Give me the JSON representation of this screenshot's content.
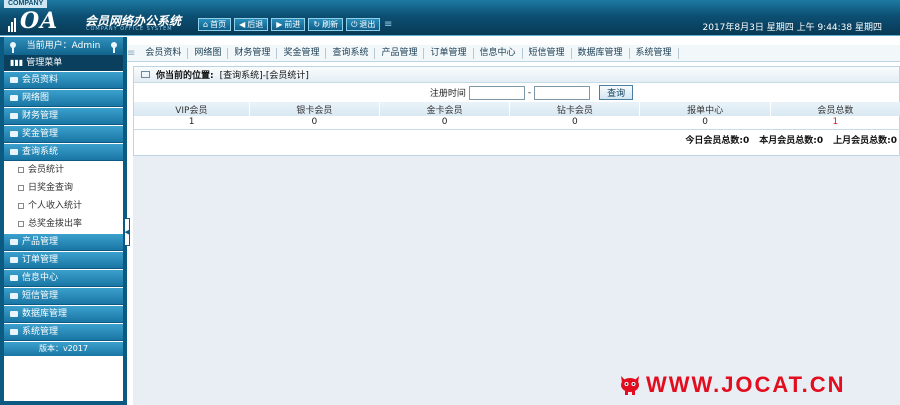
{
  "header": {
    "company_tag": "COMPANY",
    "logo_mark": "OA",
    "system_title": "会员网络办公系统",
    "system_subtitle": "COMPANY OFFICE SYSTEM",
    "toolbar": [
      {
        "label": "首页",
        "icon": "home-icon"
      },
      {
        "label": "后退",
        "icon": "back-arrow-icon"
      },
      {
        "label": "前进",
        "icon": "forward-arrow-icon"
      },
      {
        "label": "刷新",
        "icon": "refresh-icon"
      },
      {
        "label": "退出",
        "icon": "power-icon"
      }
    ],
    "datetime": "2017年8月3日 星期四 上午 9:44:38 星期四"
  },
  "sidebar": {
    "current_user": "当前用户：Admin",
    "menu_title": "管理菜单",
    "sections_top": [
      "会员资料",
      "网络图",
      "财务管理",
      "奖金管理",
      "查询系统"
    ],
    "sub_items": [
      "会员统计",
      "日奖金查询",
      "个人收入统计",
      "总奖金拨出率"
    ],
    "sections_bottom": [
      "产品管理",
      "订单管理",
      "信息中心",
      "短信管理",
      "数据库管理",
      "系统管理"
    ],
    "version": "版本：v2017"
  },
  "nav": {
    "items": [
      "会员资料",
      "网络图",
      "财务管理",
      "奖金管理",
      "查询系统",
      "产品管理",
      "订单管理",
      "信息中心",
      "短信管理",
      "数据库管理",
      "系统管理"
    ]
  },
  "main": {
    "breadcrumb_label": "你当前的位置:",
    "breadcrumb_path": "[查询系统]-[会员统计]",
    "filter_label": "注册时间",
    "filter_separator": "-",
    "start_date": "",
    "end_date": "",
    "query_button": "查询",
    "table": {
      "headers": [
        "VIP会员",
        "银卡会员",
        "金卡会员",
        "钻卡会员",
        "报单中心",
        "会员总数"
      ],
      "row": [
        "1",
        "0",
        "0",
        "0",
        "0",
        "1"
      ]
    },
    "totals": [
      {
        "label": "今日会员总数:",
        "value": "0"
      },
      {
        "label": "本月会员总数:",
        "value": "0"
      },
      {
        "label": "上月会员总数:",
        "value": "0"
      }
    ]
  },
  "watermark": {
    "text": "WWW.JOCAT.CN",
    "color": "#e20d1e"
  },
  "colors": {
    "header_dark": "#083a56",
    "sidebar_border": "#0b5a82",
    "section_blue": "#1a76a4"
  }
}
